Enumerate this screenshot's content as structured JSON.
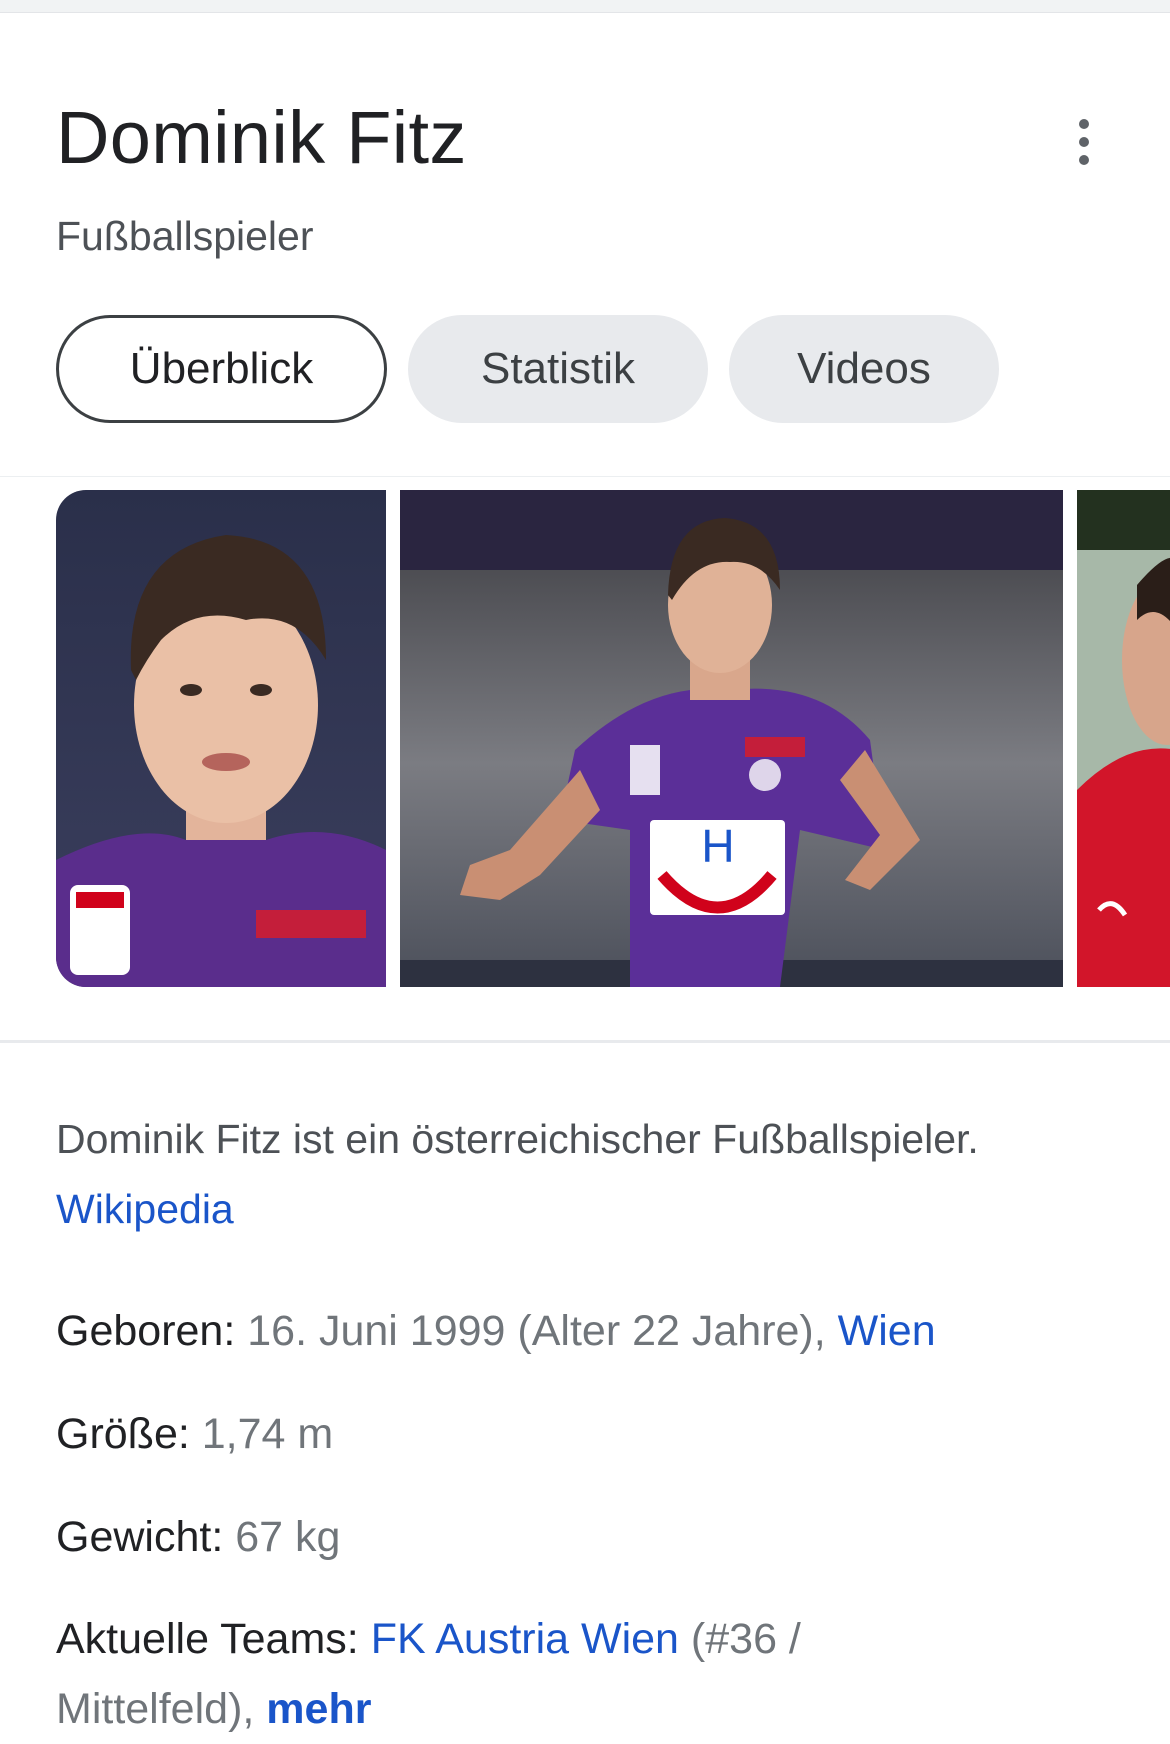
{
  "header": {
    "title": "Dominik Fitz",
    "subtitle": "Fußballspieler",
    "more_icon": "more-vert-icon"
  },
  "tabs": [
    {
      "label": "Überblick",
      "active": true
    },
    {
      "label": "Statistik",
      "active": false
    },
    {
      "label": "Videos",
      "active": false
    }
  ],
  "images": [
    {
      "alt": "Dominik Fitz portrait"
    },
    {
      "alt": "Dominik Fitz celebrating"
    },
    {
      "alt": "Dominik Fitz in red kit"
    }
  ],
  "description": {
    "text": "Dominik Fitz ist ein österreichischer Fußballspieler.",
    "source_link": "Wikipedia"
  },
  "facts": {
    "born": {
      "label": "Geboren:",
      "value": "16. Juni 1999 (Alter 22 Jahre),",
      "place_link": "Wien"
    },
    "height": {
      "label": "Größe:",
      "value": "1,74 m"
    },
    "weight": {
      "label": "Gewicht:",
      "value": "67 kg"
    },
    "teams": {
      "label": "Aktuelle Teams:",
      "team_link": "FK Austria Wien",
      "detail_1": "(#36 /",
      "detail_2": "Mittelfeld),",
      "more_link": "mehr"
    }
  },
  "colors": {
    "link": "#1a0dab",
    "muted": "#70757a",
    "chip_bg": "#e8eaed"
  }
}
